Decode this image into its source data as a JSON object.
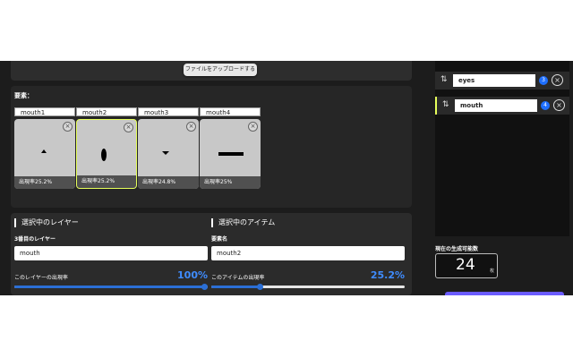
{
  "upload": {
    "button_label": "ファイルをアップロードする"
  },
  "elements": {
    "title": "要素：",
    "items": [
      {
        "name": "mouth1",
        "rate_label": "出現率25.2%",
        "selected": false
      },
      {
        "name": "mouth2",
        "rate_label": "出現率25.2%",
        "selected": true
      },
      {
        "name": "mouth3",
        "rate_label": "出現率24.8%",
        "selected": false
      },
      {
        "name": "mouth4",
        "rate_label": "出現率25%",
        "selected": false
      }
    ]
  },
  "selected_layer": {
    "heading": "選択中のレイヤー",
    "sublabel": "3番目のレイヤー",
    "value": "mouth",
    "rate_label": "このレイヤーの出現率",
    "rate_value": "100%",
    "rate_fraction": 1.0
  },
  "selected_item": {
    "heading": "選択中のアイテム",
    "sublabel": "要素名",
    "value": "mouth2",
    "rate_label": "このアイテムの出現率",
    "rate_value": "25.2%",
    "rate_fraction": 0.252
  },
  "layers": [
    {
      "name": "eyes",
      "badge": "3",
      "selected": false
    },
    {
      "name": "mouth",
      "badge": "4",
      "selected": true
    }
  ],
  "generation": {
    "label": "現在の生成可能数",
    "count": "24",
    "unit": "枚"
  },
  "colors": {
    "accent_blue": "#2b6fd6",
    "selected_highlight": "#e6ff5a",
    "badge_blue": "#1e6fff"
  },
  "icons": {
    "remove": "close-circle-icon",
    "sort": "sort-arrows-icon"
  }
}
